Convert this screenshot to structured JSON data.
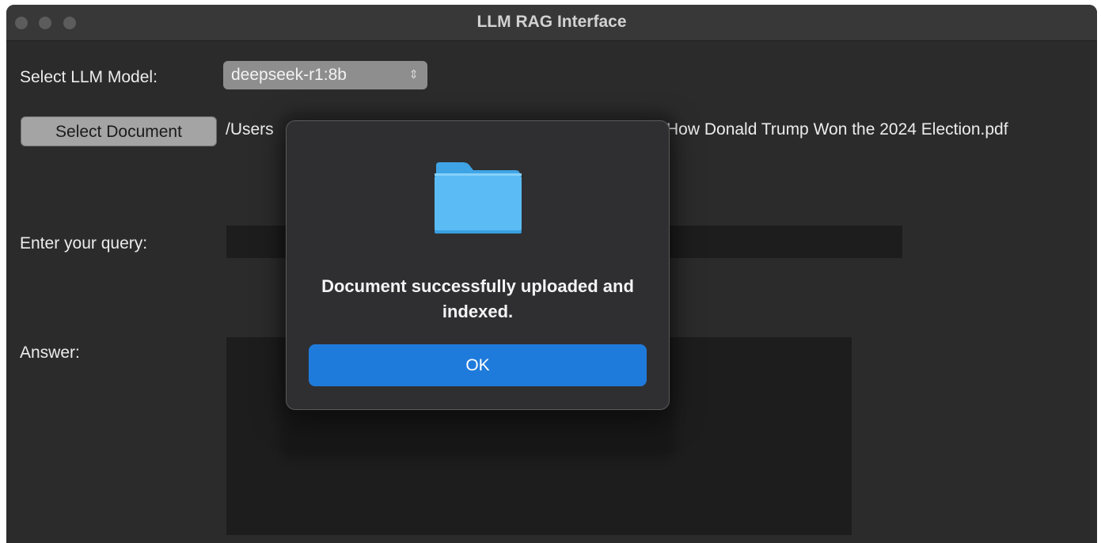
{
  "window": {
    "title": "LLM RAG Interface"
  },
  "form": {
    "model_label": "Select LLM Model:",
    "model_value": "deepseek-r1:8b",
    "select_doc_button": "Select Document",
    "path_left": "/Users",
    "path_right": "How Donald Trump Won the 2024 Election.pdf",
    "query_label": "Enter your query:",
    "query_value": "",
    "answer_label": "Answer:",
    "answer_value": ""
  },
  "dialog": {
    "icon": "folder-icon",
    "message": "Document successfully uploaded and indexed.",
    "ok_label": "OK"
  },
  "colors": {
    "window_bg": "#2b2b2b",
    "titlebar_bg": "#383838",
    "accent": "#1f7bdb",
    "folder_blue": "#5bbcf5"
  }
}
